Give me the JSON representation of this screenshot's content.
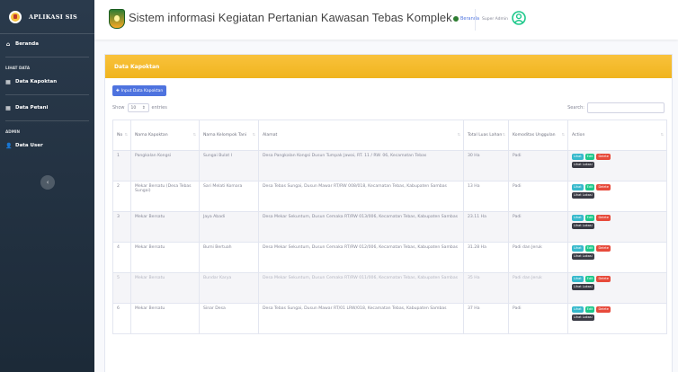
{
  "sidebar": {
    "brand": "APLIKASI SIS",
    "items": [
      {
        "label": "Beranda",
        "icon": "home-icon"
      },
      {
        "label": "Data Kapoktan",
        "icon": "table-icon"
      },
      {
        "label": "Data Petani",
        "icon": "table-icon"
      },
      {
        "label": "Data User",
        "icon": "user-icon"
      }
    ],
    "headings": [
      "LIHAT DATA",
      "ADMIN"
    ]
  },
  "topbar": {
    "title": "Sistem informasi Kegiatan Pertanian Kawasan Tebas Komplek",
    "home": "Beranda",
    "user": "Super Admin"
  },
  "card": {
    "title": "Data Kapoktan",
    "add_button": "Input Data Kapoktan",
    "show_label": "Show",
    "entries_value": "10",
    "entries_label": "entries",
    "search_label": "Search:"
  },
  "table": {
    "columns": [
      "No",
      "Nama Kapoktan",
      "Nama Kelompok Tani",
      "Alamat",
      "Total Luas Lahan",
      "Komoditas Unggulan",
      "Action"
    ],
    "rows": [
      {
        "no": "1",
        "kapoktan": "Pangkalan Kongsi",
        "kelompok": "Sungai Bulat I",
        "alamat": "Desa Pangkalan Kongsi Dusun Tumpak Jawai, RT. 11 / RW. 06, Kecamatan Tebas",
        "luas": "30 Ha",
        "komoditas": "Padi"
      },
      {
        "no": "2",
        "kapoktan": "Mekar Bersatu (Desa Tebas Sungai)",
        "kelompok": "Sari Melati Komara",
        "alamat": "Desa Tebas Sungai, Dusun Mawar RT/RW 008/018, Kecamatan Tebas, Kabupaten Sambas",
        "luas": "13 Ha",
        "komoditas": "Padi"
      },
      {
        "no": "3",
        "kapoktan": "Mekar Bersatu",
        "kelompok": "Jaya Abadi",
        "alamat": "Desa Mekar Sekuntum, Dusun Cemaka RT/RW 013/006, Kecamatan Tebas, Kabupaten Sambas",
        "luas": "23.11 Ha",
        "komoditas": "Padi"
      },
      {
        "no": "4",
        "kapoktan": "Mekar Bersatu",
        "kelompok": "Bumi Bertuah",
        "alamat": "Desa Mekar Sekuntum, Dusun Cemaka RT/RW 012/006, Kecamatan Tebas, Kabupaten Sambas",
        "luas": "31.28 Ha",
        "komoditas": "Padi dan Jeruk"
      },
      {
        "no": "5",
        "kapoktan": "Mekar Bersatu",
        "kelompok": "Bundar Karya",
        "alamat": "Desa Mekar Sekuntum, Dusun Cemaka RT/RW 011/006, Kecamatan Tebas, Kabupaten Sambas",
        "luas": "35 Ha",
        "komoditas": "Padi dan Jeruk"
      },
      {
        "no": "6",
        "kapoktan": "Mekar Bersatu",
        "kelompok": "Sinar Desa",
        "alamat": "Desa Tebas Sungai, Dusun Mawar RT/01 LRW/018, Kecamatan Tebas, Kabupaten Sambas",
        "luas": "37 Ha",
        "komoditas": "Padi"
      }
    ],
    "action_labels": {
      "lihat": "Lihat",
      "edit": "Edit",
      "delete": "Delete",
      "lokasi": "Lihat Lokasi"
    }
  },
  "colors": {
    "sidebar": "#1f2d3d",
    "header": "#f6c23e",
    "primary": "#4e73df",
    "info": "#36b9cc",
    "success": "#1cc88a",
    "danger": "#e74a3b",
    "dark": "#3a3b45"
  }
}
